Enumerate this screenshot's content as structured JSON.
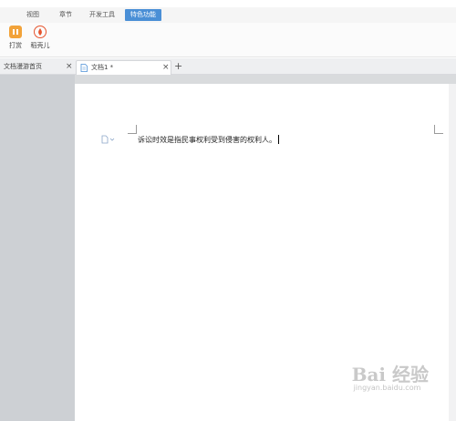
{
  "menubar": {
    "items": [
      {
        "label": "视图"
      },
      {
        "label": "章节"
      },
      {
        "label": "开发工具"
      },
      {
        "label": "特色功能"
      }
    ]
  },
  "ribbon": {
    "buttons": [
      {
        "label": "打赏",
        "icon": "reward-icon"
      },
      {
        "label": "稻壳儿",
        "icon": "docer-icon"
      }
    ]
  },
  "tabs": {
    "items": [
      {
        "label": "文档漫游首页"
      },
      {
        "label": "文档1 *"
      }
    ],
    "close_label": "×",
    "add_label": "+"
  },
  "document": {
    "text": "诉讼时效是指民事权利受到侵害的权利人。"
  },
  "watermark": {
    "main": "Bai 经验",
    "sub": "jingyan.baidu.com"
  },
  "colors": {
    "accent": "#4a8fd6",
    "reward": "#f2a33a",
    "docer": "#e6542e"
  }
}
